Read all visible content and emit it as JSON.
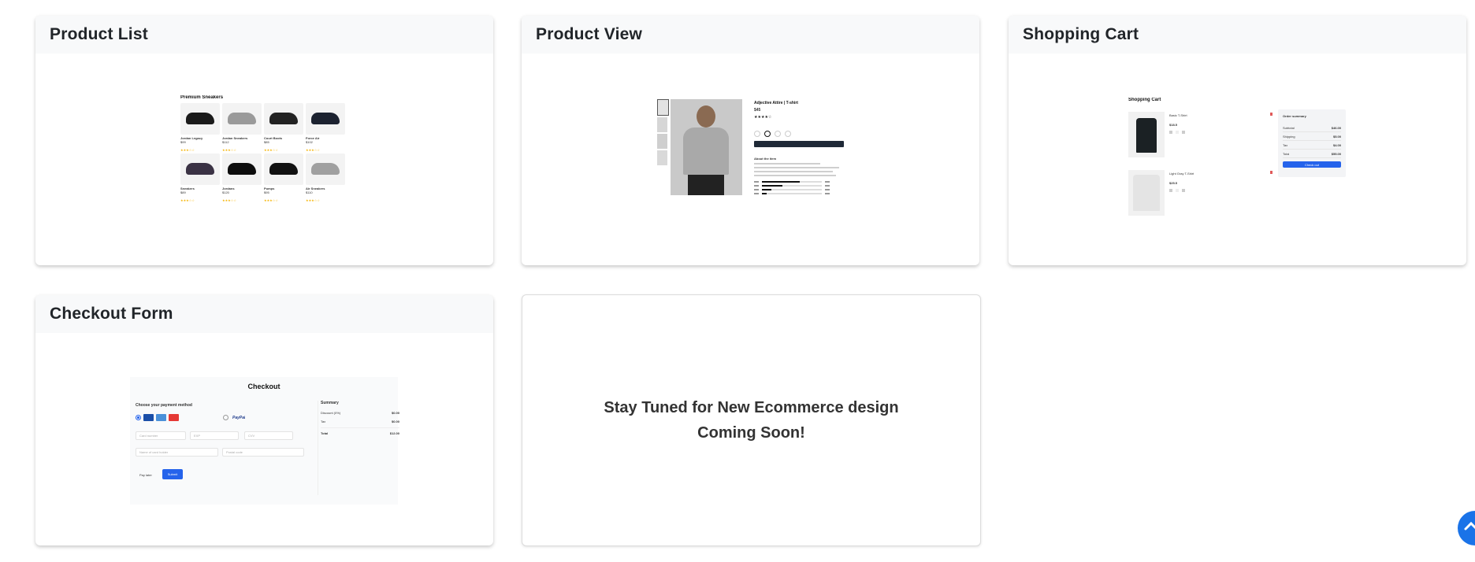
{
  "cards": {
    "product_list": {
      "title": "Product List"
    },
    "product_view": {
      "title": "Product View"
    },
    "shopping_cart": {
      "title": "Shopping Cart"
    },
    "checkout_form": {
      "title": "Checkout Form"
    },
    "coming_soon": {
      "line1": "Stay Tuned for New Ecommerce design",
      "line2": "Coming Soon!"
    }
  },
  "previews": {
    "product_list": {
      "heading": "Premium Sneakers",
      "products": [
        {
          "name": "Jordan Legacy",
          "price": "$99",
          "shoe_color": "#1a1a1a"
        },
        {
          "name": "Jordan Sneakers",
          "price": "$112",
          "shoe_color": "#9a9a9a"
        },
        {
          "name": "Court Boots",
          "price": "$85",
          "shoe_color": "#222222"
        },
        {
          "name": "Force Air",
          "price": "$102",
          "shoe_color": "#1c2230"
        },
        {
          "name": "Sneakers",
          "price": "$89",
          "shoe_color": "#3a3244"
        },
        {
          "name": "Jordans",
          "price": "$120",
          "shoe_color": "#0d0d0d"
        },
        {
          "name": "Pumps",
          "price": "$95",
          "shoe_color": "#111111"
        },
        {
          "name": "Air Sneakers",
          "price": "$110",
          "shoe_color": "#a0a0a0"
        }
      ]
    },
    "product_view": {
      "title": "Adjective Attire | T-shirt",
      "price": "$45",
      "about_heading": "About the item"
    },
    "cart": {
      "heading": "Shopping Cart",
      "items": [
        {
          "name": "Basic T-Shirt",
          "price": "$18.5"
        },
        {
          "name": "Light Gray T-Shirt",
          "price": "$25.5"
        }
      ],
      "summary_heading": "Order summary",
      "summary_rows": [
        {
          "label": "Subtotal",
          "value": "$46.00"
        },
        {
          "label": "Shipping",
          "value": "$5.00"
        },
        {
          "label": "Tax",
          "value": "$4.00"
        },
        {
          "label": "Total",
          "value": "$55.00"
        }
      ],
      "checkout_label": "Check out"
    },
    "checkout": {
      "heading": "Checkout",
      "payment_heading": "Choose your payment method",
      "paypal_label": "PayPal",
      "card_number_placeholder": "Card number",
      "exp_placeholder": "EXP",
      "cvv_placeholder": "CVV",
      "name_placeholder": "Name of card holder",
      "postal_placeholder": "Postal code",
      "pay_later_label": "Pay later",
      "submit_label": "Submit",
      "summary_heading": "Summary",
      "summary_rows": [
        {
          "label": "Discount (0%)",
          "value": "$0.00"
        },
        {
          "label": "Tax",
          "value": "$0.00"
        },
        {
          "label": "Total",
          "value": "$12.00"
        }
      ]
    }
  },
  "icons": {
    "scroll_top": "arrow-up-icon"
  },
  "colors": {
    "accent": "#2563eb",
    "header_bg": "#f8f9fa"
  }
}
